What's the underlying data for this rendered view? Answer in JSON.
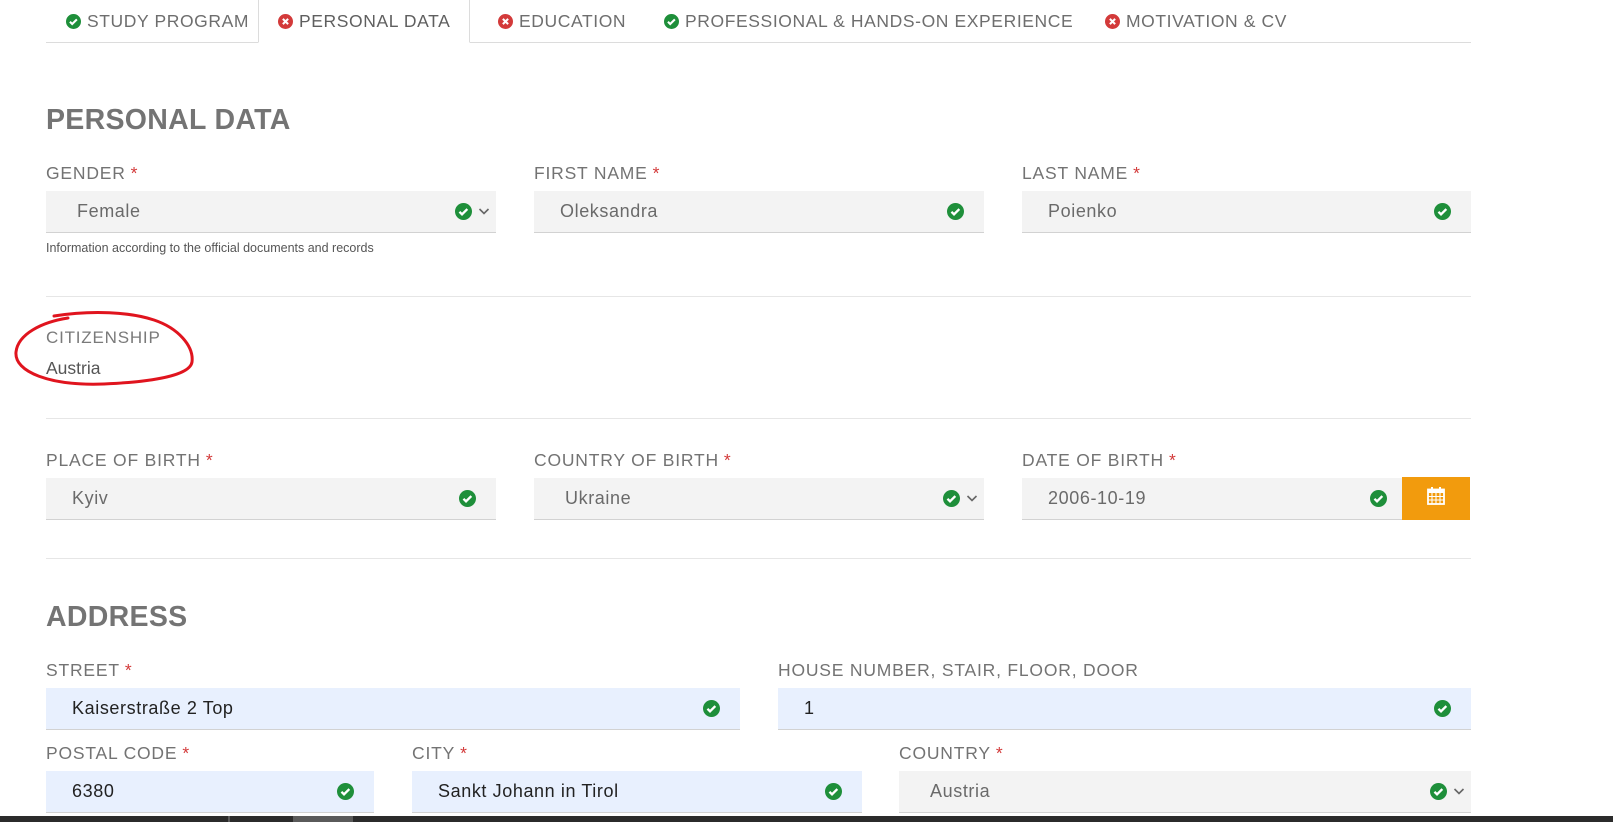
{
  "tabs": [
    {
      "label": "STUDY PROGRAM",
      "status": "complete"
    },
    {
      "label": "PERSONAL DATA",
      "status": "error"
    },
    {
      "label": "EDUCATION",
      "status": "error"
    },
    {
      "label": "PROFESSIONAL & HANDS-ON EXPERIENCE",
      "status": "complete"
    },
    {
      "label": "MOTIVATION & CV",
      "status": "error"
    }
  ],
  "personal": {
    "title": "PERSONAL DATA",
    "gender": {
      "label": "GENDER",
      "required": "*",
      "value": "Female"
    },
    "first_name": {
      "label": "FIRST NAME",
      "required": "*",
      "value": "Oleksandra"
    },
    "last_name": {
      "label": "LAST NAME",
      "required": "*",
      "value": "Poienko"
    },
    "hint": "Information according to the official documents and records",
    "citizenship": {
      "label": "CITIZENSHIP",
      "value": "Austria"
    },
    "place_of_birth": {
      "label": "PLACE OF BIRTH",
      "required": "*",
      "value": "Kyiv"
    },
    "country_of_birth": {
      "label": "COUNTRY OF BIRTH",
      "required": "*",
      "value": "Ukraine"
    },
    "date_of_birth": {
      "label": "DATE OF BIRTH",
      "required": "*",
      "value": "2006-10-19"
    }
  },
  "address": {
    "title": "ADDRESS",
    "street": {
      "label": "STREET",
      "required": "*",
      "value": "Kaiserstraße 2 Top"
    },
    "house": {
      "label": "HOUSE NUMBER, STAIR, FLOOR, DOOR",
      "value": "1"
    },
    "postal": {
      "label": "POSTAL CODE",
      "required": "*",
      "value": "6380"
    },
    "city": {
      "label": "CITY",
      "required": "*",
      "value": "Sankt Johann in Tirol"
    },
    "country": {
      "label": "COUNTRY",
      "required": "*",
      "value": "Austria"
    }
  },
  "colors": {
    "ok": "#1e8f3a",
    "error": "#d33a3a",
    "accent": "#f29b0d",
    "annotation": "#e0141e"
  },
  "icons": {
    "ok": "check-circle-icon",
    "error": "x-circle-icon",
    "calendar": "calendar-icon",
    "chevron": "chevron-down-icon"
  }
}
